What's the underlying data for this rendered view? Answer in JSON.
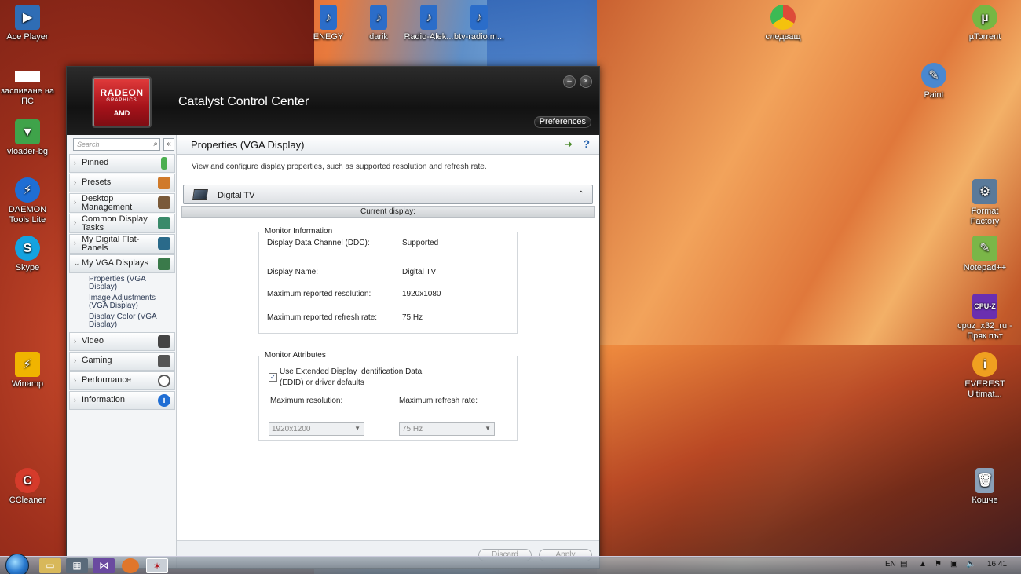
{
  "desktop": {
    "icons": [
      {
        "label": "Ace Player",
        "color": "#2f6db5"
      },
      {
        "label": "заспиване на ПС",
        "color": "#ffffff"
      },
      {
        "label": "vloader-bg",
        "color": "#3fa34a"
      },
      {
        "label": "DAEMON Tools Lite",
        "color": "#1f6ed4"
      },
      {
        "label": "Skype",
        "color": "#14a3e0"
      },
      {
        "label": "Winamp",
        "color": "#f0b400"
      },
      {
        "label": "CCleaner",
        "color": "#d63b2b"
      },
      {
        "label": "ENEGY",
        "color": "#2b6dc9"
      },
      {
        "label": "darik",
        "color": "#2b6dc9"
      },
      {
        "label": "Radio-Alek...",
        "color": "#2b6dc9"
      },
      {
        "label": "btv-radio.m...",
        "color": "#2b6dc9"
      },
      {
        "label": "следващ",
        "color": "#dd4b39"
      },
      {
        "label": "µTorrent",
        "color": "#76b743"
      },
      {
        "label": "Paint",
        "color": "#4a88d0"
      },
      {
        "label": "Format Factory",
        "color": "#5a7a9a"
      },
      {
        "label": "Notepad++",
        "color": "#7ab648"
      },
      {
        "label": "cpuz_x32_ru - Пряк път",
        "color": "#6a2fb0"
      },
      {
        "label": "EVEREST Ultimat...",
        "color": "#f0a020"
      },
      {
        "label": "Кошче",
        "color": "#8aa0b8"
      }
    ]
  },
  "ccc": {
    "logo_l1": "RADEON",
    "logo_l2": "GRAPHICS",
    "logo_l3": "AMD",
    "title": "Catalyst Control Center",
    "minimize": "–",
    "close": "×",
    "preferences": "Preferences",
    "search_placeholder": "Search",
    "nav": [
      {
        "label": "Pinned",
        "color": "#4caf50"
      },
      {
        "label": "Presets",
        "color": "#d07a2a"
      },
      {
        "label": "Desktop Management",
        "color": "#7a5a3a"
      },
      {
        "label": "Common Display Tasks",
        "color": "#3a8a6a"
      },
      {
        "label": "My Digital Flat-Panels",
        "color": "#2a6a8a"
      },
      {
        "label": "My VGA Displays",
        "color": "#3a7a4a"
      }
    ],
    "vga_sub": [
      "Properties (VGA Display)",
      "Image Adjustments (VGA Display)",
      "Display Color (VGA Display)"
    ],
    "nav2": [
      {
        "label": "Video",
        "color": "#444444"
      },
      {
        "label": "Gaming",
        "color": "#555555"
      },
      {
        "label": "Performance",
        "color": "#666666"
      },
      {
        "label": "Information",
        "color": "#1f6ed4"
      }
    ],
    "page_title": "Properties (VGA Display)",
    "help": "?",
    "description": "View and configure display properties, such as supported resolution and refresh rate.",
    "display_name_selected": "Digital TV",
    "current_display_label": "Current display:",
    "monitor_info": {
      "title": "Monitor Information",
      "ddc_label": "Display Data Channel (DDC):",
      "ddc_value": "Supported",
      "name_label": "Display Name:",
      "name_value": "Digital TV",
      "maxres_label": "Maximum reported resolution:",
      "maxres_value": "1920x1080",
      "maxrefresh_label": "Maximum reported refresh rate:",
      "maxrefresh_value": "75 Hz"
    },
    "monitor_attr": {
      "title": "Monitor Attributes",
      "edid_line1": "Use Extended Display Identification Data",
      "edid_line2": "(EDID) or driver defaults",
      "edid_checked": true,
      "res_label": "Maximum resolution:",
      "res_value": "1920x1200",
      "refresh_label": "Maximum refresh rate:",
      "refresh_value": "75 Hz"
    },
    "discard": "Discard",
    "apply": "Apply"
  },
  "taskbar": {
    "language": "EN",
    "time": "16:41"
  }
}
